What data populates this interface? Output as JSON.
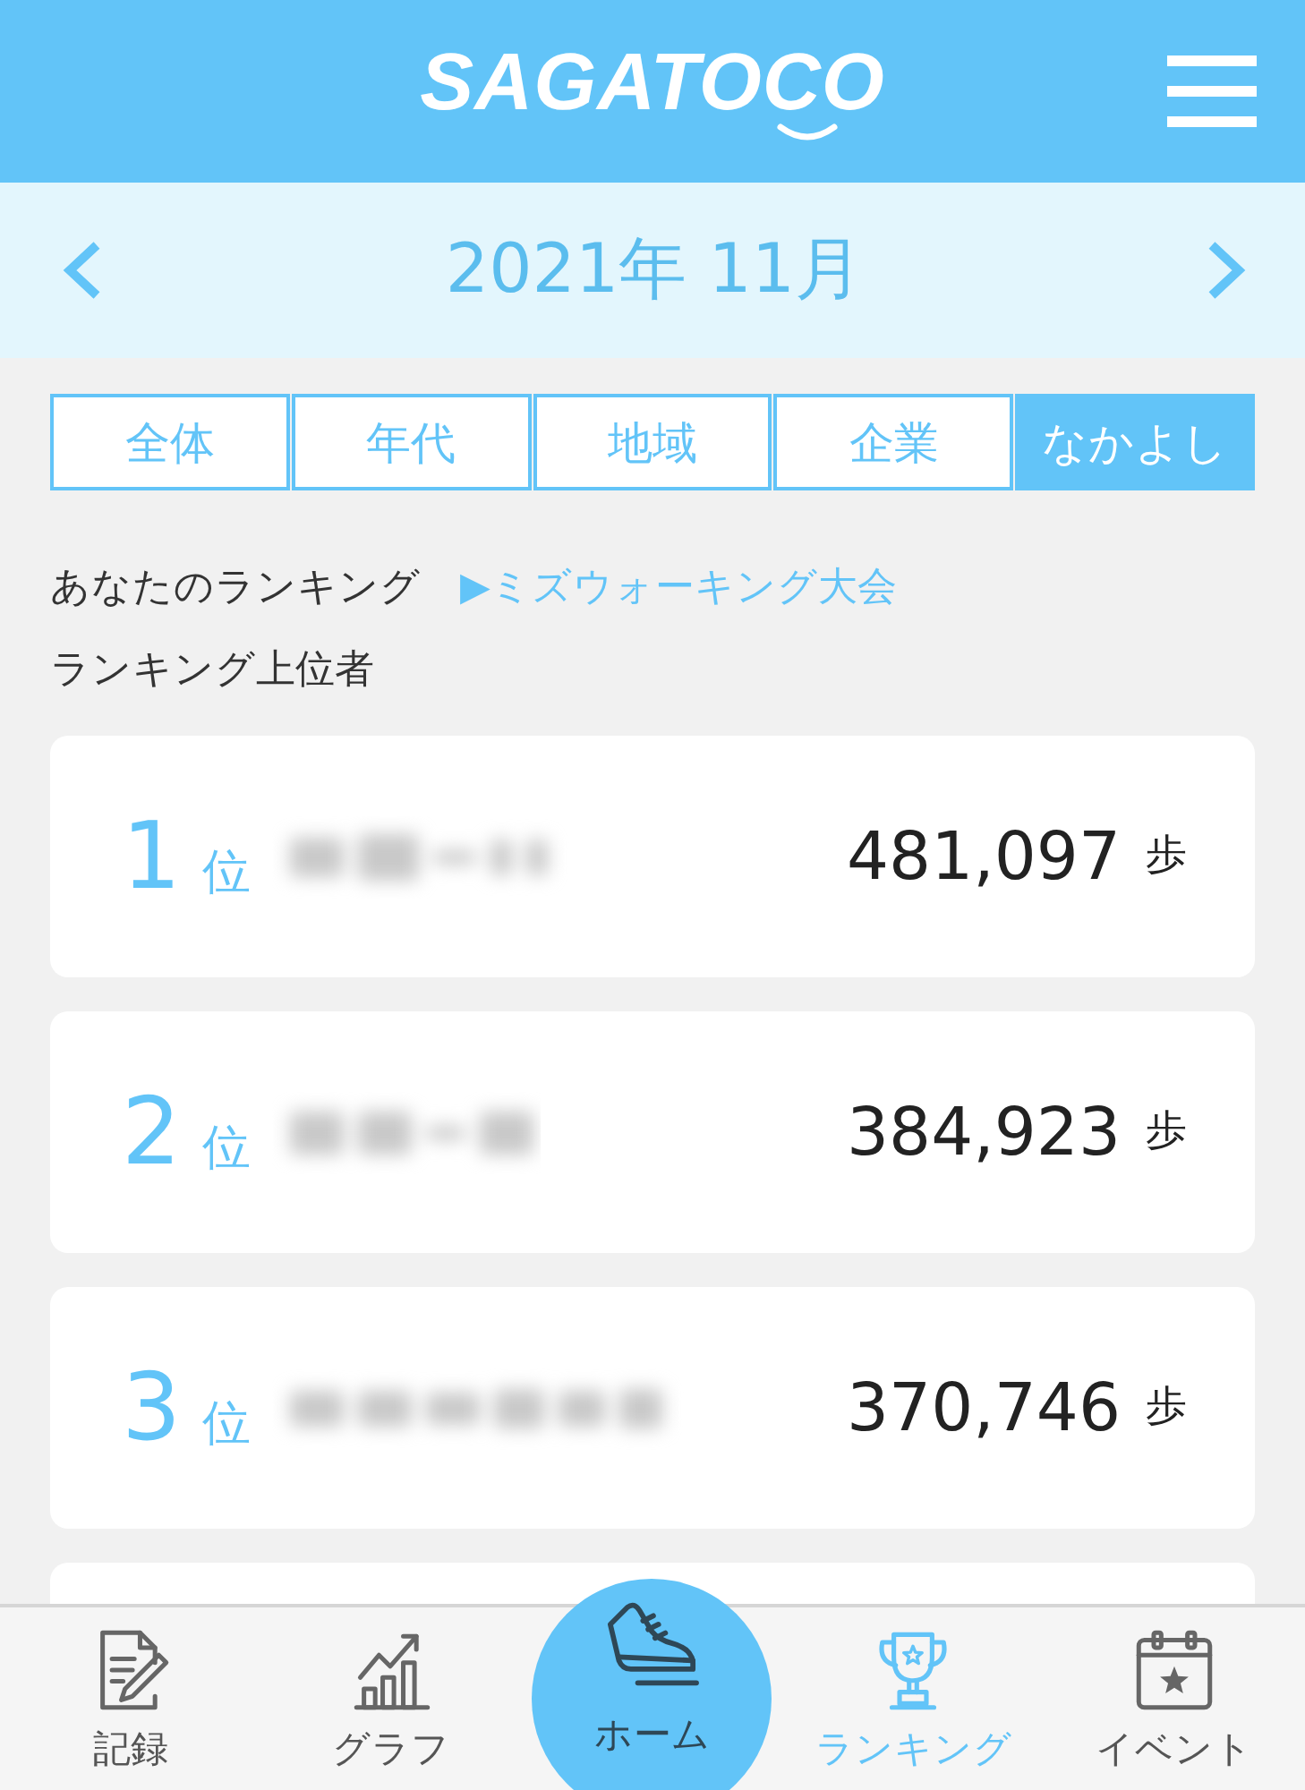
{
  "header": {
    "logo": "SAGATOCO"
  },
  "month_nav": {
    "title": "2021年 11月"
  },
  "tabs": [
    {
      "label": "全体",
      "selected": false
    },
    {
      "label": "年代",
      "selected": false
    },
    {
      "label": "地域",
      "selected": false
    },
    {
      "label": "企業",
      "selected": false
    },
    {
      "label": "なかよし",
      "selected": true
    }
  ],
  "your_ranking": {
    "label": "あなたのランキング",
    "link": "▶ミズウォーキング大会"
  },
  "top_rankers_title": "ランキング上位者",
  "rankings": [
    {
      "rank": "1",
      "rank_unit": "位",
      "steps": "481,097",
      "steps_unit": "歩"
    },
    {
      "rank": "2",
      "rank_unit": "位",
      "steps": "384,923",
      "steps_unit": "歩"
    },
    {
      "rank": "3",
      "rank_unit": "位",
      "steps": "370,746",
      "steps_unit": "歩"
    }
  ],
  "bottom_nav": [
    {
      "label": "記録",
      "selected": false,
      "kind": "normal"
    },
    {
      "label": "グラフ",
      "selected": false,
      "kind": "normal"
    },
    {
      "label": "ホーム",
      "selected": false,
      "kind": "center"
    },
    {
      "label": "ランキング",
      "selected": true,
      "kind": "normal"
    },
    {
      "label": "イベント",
      "selected": false,
      "kind": "normal"
    }
  ]
}
